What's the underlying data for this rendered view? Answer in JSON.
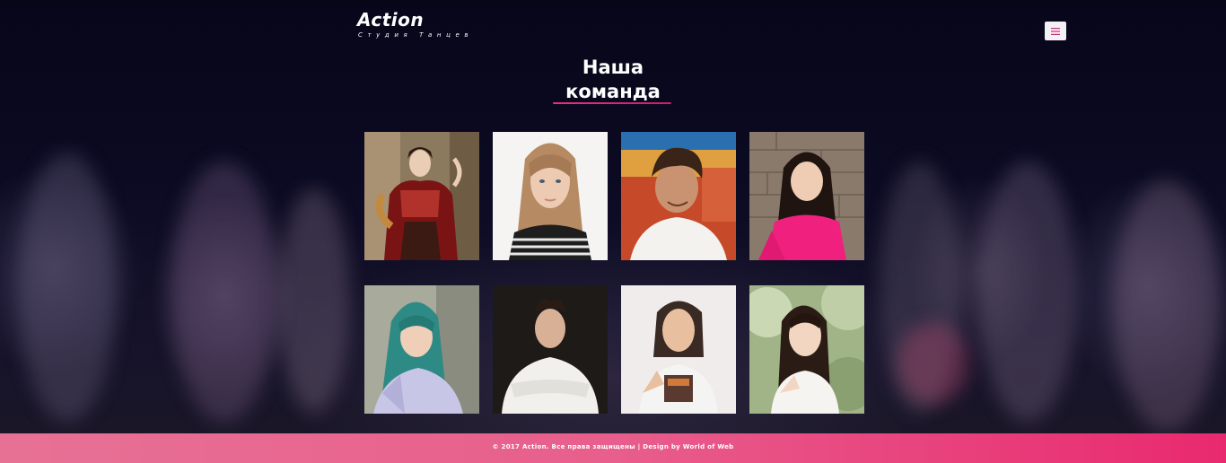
{
  "header": {
    "logo": "Action",
    "tagline": "Студия Танцев",
    "menu_icon": "hamburger-menu-icon"
  },
  "section": {
    "title_line1": "Наша",
    "title_line2": "команда",
    "accent_color": "#e7327a"
  },
  "team": [
    {
      "photo": "dancer-in-folk-costume"
    },
    {
      "photo": "young-woman-striped-top"
    },
    {
      "photo": "young-man-smiling"
    },
    {
      "photo": "young-woman-pink-top"
    },
    {
      "photo": "woman-teal-hair"
    },
    {
      "photo": "man-white-sweater"
    },
    {
      "photo": "woman-graphic-tee"
    },
    {
      "photo": "young-woman-outdoors"
    }
  ],
  "footer": {
    "text": "© 2017 Action. Все права защищены | Design by World of Web",
    "colors": [
      "#e77195",
      "#e9296e"
    ]
  }
}
